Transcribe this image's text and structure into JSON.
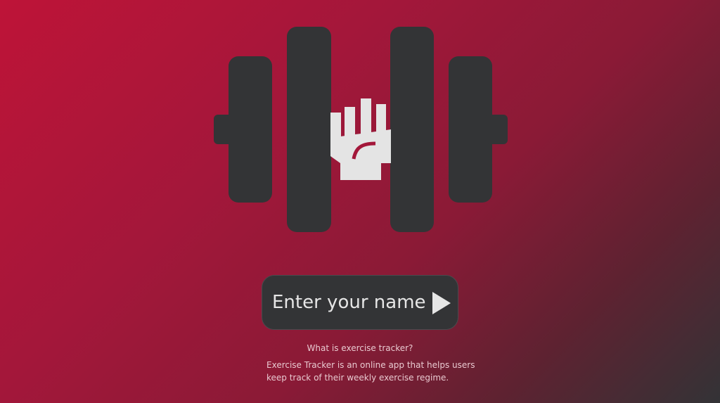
{
  "colors": {
    "gradient_start": "#be1438",
    "gradient_end": "#333336",
    "weight_color": "#333436",
    "fist_color": "#e4e4e4",
    "text_light": "#e6e6e6"
  },
  "logo": {
    "icon": "dumbbell-fist-icon"
  },
  "name_form": {
    "placeholder": "Enter your name",
    "value": "",
    "submit_icon": "play-triangle-icon"
  },
  "info": {
    "title": "What is exercise tracker?",
    "body": "Exercise Tracker is an online app that helps users keep track of their weekly exercise regime."
  }
}
